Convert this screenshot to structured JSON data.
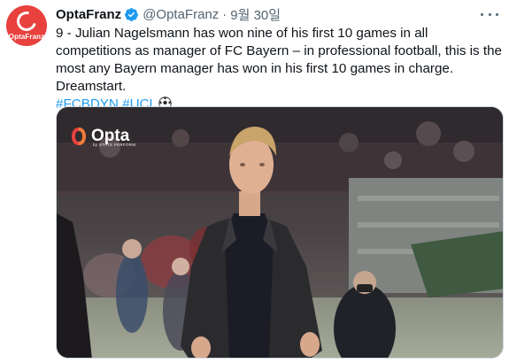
{
  "tweet": {
    "display_name": "OptaFranz",
    "handle": "@OptaFranz",
    "separator": "·",
    "date": "9월 30일",
    "body": "9 - Julian Nagelsmann has won nine of his first 10 games in all competitions as manager of FC Bayern – in professional football, this is the most any Bayern manager has won in his first 10 games in charge. Dreamstart.",
    "hashtags": [
      "#FCBDYN",
      "#UCL"
    ],
    "avatar_text": "OptaFranz",
    "media_logo_text": "Opta",
    "media_logo_subtext": "by STATS PERFORM"
  },
  "icons": {
    "verified": "verified-badge-icon",
    "more": "more-options-icon",
    "soccer": "soccer-ball-emoji"
  },
  "colors": {
    "brand_red": "#e8413e",
    "link_blue": "#1d9bf0",
    "secondary_text": "#536471"
  }
}
